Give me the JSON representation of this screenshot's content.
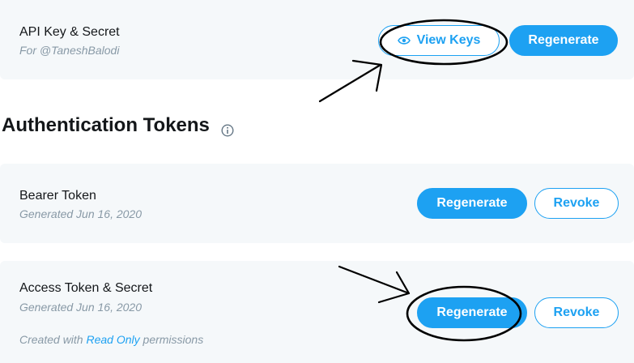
{
  "api_key_card": {
    "title": "API Key & Secret",
    "subtitle": "For @TaneshBalodi",
    "view_keys_label": "View Keys",
    "regenerate_label": "Regenerate"
  },
  "auth_tokens": {
    "heading": "Authentication Tokens"
  },
  "bearer_card": {
    "title": "Bearer Token",
    "subtitle": "Generated Jun 16, 2020",
    "regenerate_label": "Regenerate",
    "revoke_label": "Revoke"
  },
  "access_card": {
    "title": "Access Token & Secret",
    "subtitle": "Generated Jun 16, 2020",
    "permissions_prefix": "Created with",
    "permissions_link": "Read Only",
    "permissions_suffix": "permissions",
    "regenerate_label": "Regenerate",
    "revoke_label": "Revoke"
  },
  "colors": {
    "accent": "#1da1f2",
    "card_bg": "#f5f8fa",
    "muted_text": "#8899a6",
    "annotation": "#000000"
  },
  "icons": [
    "eye-icon",
    "info-icon",
    "arrow-annotation",
    "ellipse-annotation"
  ]
}
